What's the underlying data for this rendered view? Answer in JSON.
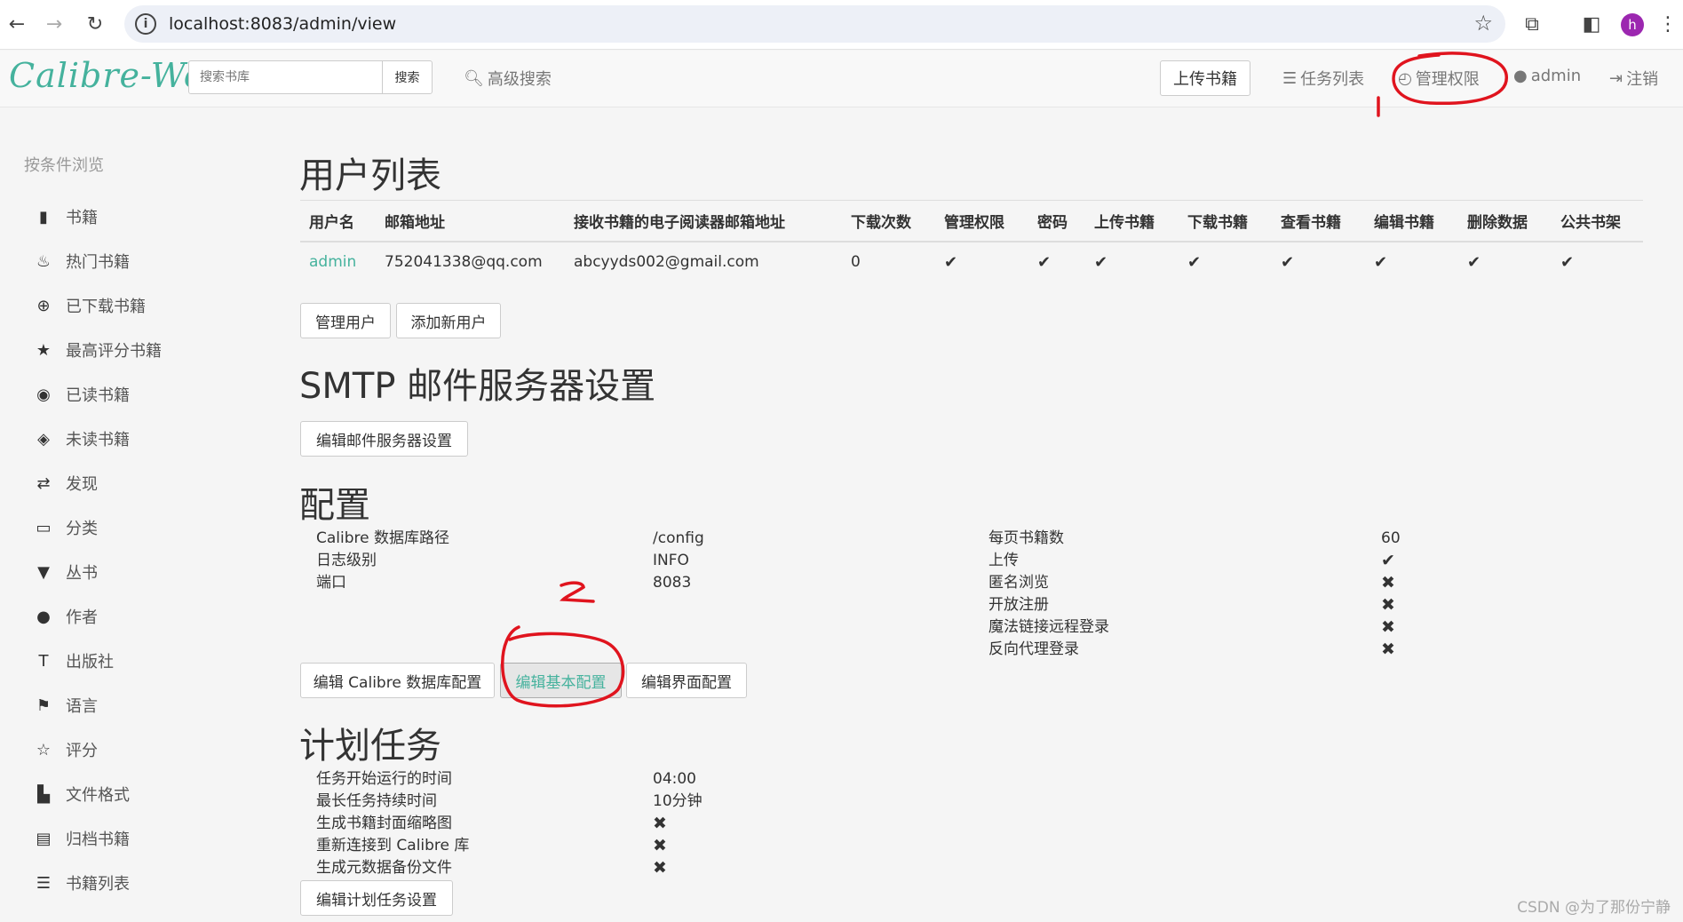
{
  "browser": {
    "url": "localhost:8083/admin/view",
    "profile_initial": "h"
  },
  "header": {
    "brand": "Calibre-Web",
    "search_placeholder": "搜索书库",
    "search_button": "搜索",
    "advanced_search": "高级搜索",
    "upload": "上传书籍",
    "tasks": "任务列表",
    "admin_panel": "管理权限",
    "user": "admin",
    "logout": "注销"
  },
  "sidebar": {
    "heading": "按条件浏览",
    "items": [
      {
        "label": "书籍",
        "icon": "book-icon",
        "glyph": "▮"
      },
      {
        "label": "热门书籍",
        "icon": "fire-icon",
        "glyph": "♨"
      },
      {
        "label": "已下载书籍",
        "icon": "download-circle-icon",
        "glyph": "⊕"
      },
      {
        "label": "最高评分书籍",
        "icon": "star-icon",
        "glyph": "★"
      },
      {
        "label": "已读书籍",
        "icon": "eye-icon",
        "glyph": "◉"
      },
      {
        "label": "未读书籍",
        "icon": "eye-slash-icon",
        "glyph": "◈"
      },
      {
        "label": "发现",
        "icon": "random-icon",
        "glyph": "⇄"
      },
      {
        "label": "分类",
        "icon": "inbox-icon",
        "glyph": "▭"
      },
      {
        "label": "丛书",
        "icon": "bookmark-icon",
        "glyph": "▼"
      },
      {
        "label": "作者",
        "icon": "user-icon",
        "glyph": "●"
      },
      {
        "label": "出版社",
        "icon": "text-size-icon",
        "glyph": "T"
      },
      {
        "label": "语言",
        "icon": "flag-icon",
        "glyph": "⚑"
      },
      {
        "label": "评分",
        "icon": "star-empty-icon",
        "glyph": "☆"
      },
      {
        "label": "文件格式",
        "icon": "file-icon",
        "glyph": "▙"
      },
      {
        "label": "归档书籍",
        "icon": "trash-icon",
        "glyph": "▤"
      },
      {
        "label": "书籍列表",
        "icon": "list-icon",
        "glyph": "☰"
      }
    ]
  },
  "users": {
    "title": "用户列表",
    "columns": [
      "用户名",
      "邮箱地址",
      "接收书籍的电子阅读器邮箱地址",
      "下载次数",
      "管理权限",
      "密码",
      "上传书籍",
      "下载书籍",
      "查看书籍",
      "编辑书籍",
      "删除数据",
      "公共书架"
    ],
    "rows": [
      {
        "username": "admin",
        "email": "752041338@qq.com",
        "kindle": "abcyyds002@gmail.com",
        "downloads": "0",
        "checks": [
          "✔",
          "✔",
          "✔",
          "✔",
          "✔",
          "✔",
          "✔",
          "✔"
        ]
      }
    ],
    "manage_button": "管理用户",
    "add_button": "添加新用户"
  },
  "smtp": {
    "title": "SMTP 邮件服务器设置",
    "edit_button": "编辑邮件服务器设置"
  },
  "config": {
    "title": "配置",
    "left": [
      {
        "label": "Calibre 数据库路径",
        "value": "/config"
      },
      {
        "label": "日志级别",
        "value": "INFO"
      },
      {
        "label": "端口",
        "value": "8083"
      }
    ],
    "right": [
      {
        "label": "每页书籍数",
        "value": "60"
      },
      {
        "label": "上传",
        "value": "✔"
      },
      {
        "label": "匿名浏览",
        "value": "✖"
      },
      {
        "label": "开放注册",
        "value": "✖"
      },
      {
        "label": "魔法链接远程登录",
        "value": "✖"
      },
      {
        "label": "反向代理登录",
        "value": "✖"
      }
    ],
    "btn_db": "编辑 Calibre 数据库配置",
    "btn_basic": "编辑基本配置",
    "btn_ui": "编辑界面配置"
  },
  "schedule": {
    "title": "计划任务",
    "rows": [
      {
        "label": "任务开始运行的时间",
        "value": "04:00"
      },
      {
        "label": "最长任务持续时间",
        "value": "10分钟"
      },
      {
        "label": "生成书籍封面缩略图",
        "value": "✖"
      },
      {
        "label": "重新连接到 Calibre 库",
        "value": "✖"
      },
      {
        "label": "生成元数据备份文件",
        "value": "✖"
      }
    ],
    "edit_button": "编辑计划任务设置"
  },
  "annotations": {
    "mark1": "1",
    "mark2": "2",
    "color": "#e0141e"
  },
  "watermark": "CSDN @为了那份宁静",
  "colors": {
    "accent": "#45b29d"
  }
}
